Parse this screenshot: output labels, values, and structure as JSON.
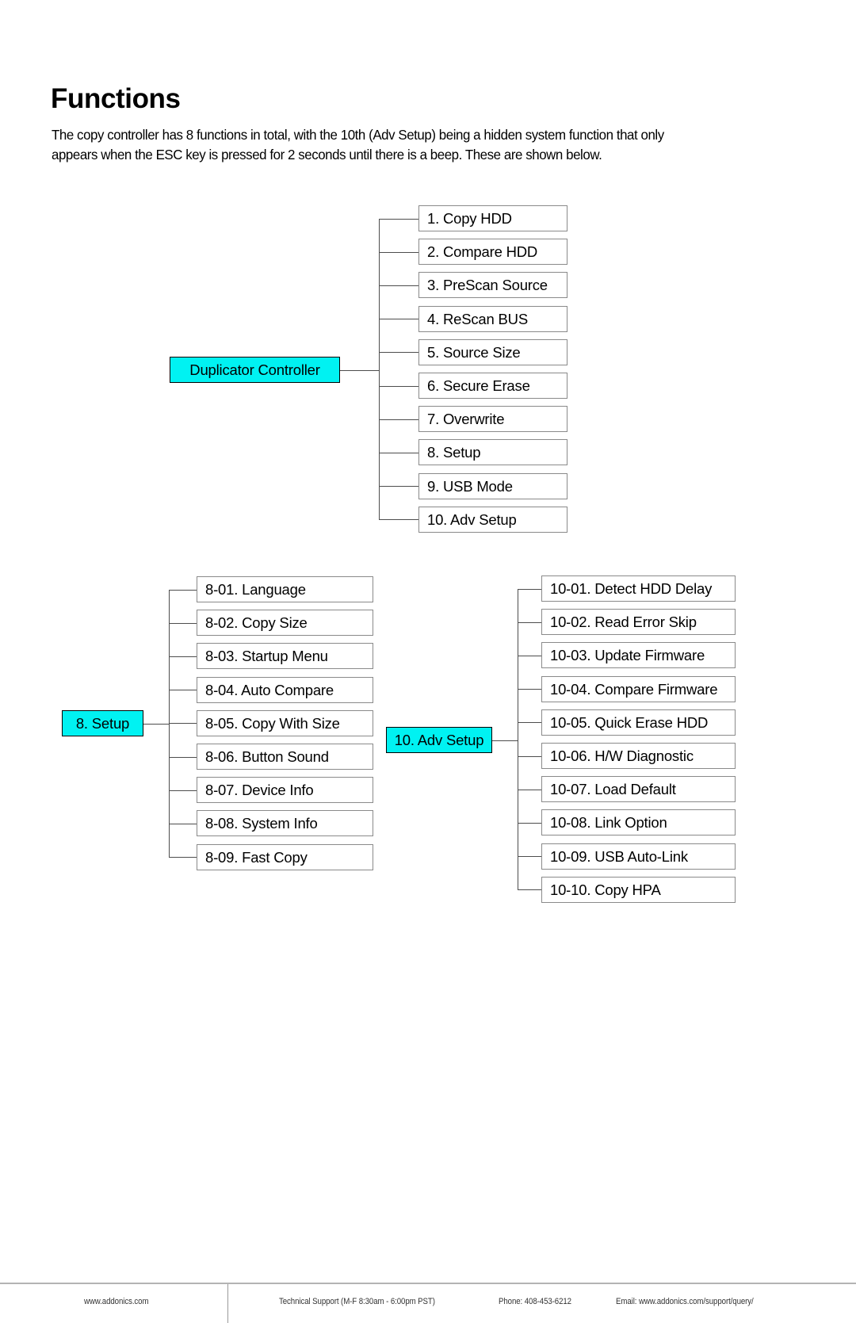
{
  "page": {
    "title": "Functions",
    "intro": "The copy controller has 8 functions in total, with the 10th (Adv Setup) being a hidden system function that only appears when the ESC key is pressed for 2 seconds until there is a beep. These are shown below.",
    "accent_color": "#00f2f2",
    "box_border_color": "#8a8a8a",
    "line_color": "#4d4d4d"
  },
  "trees": [
    {
      "id": "duplicator-controller",
      "root": "Duplicator Controller",
      "children": [
        "1. Copy HDD",
        "2. Compare HDD",
        "3. PreScan Source",
        "4. ReScan BUS",
        "5. Source Size",
        "6. Secure Erase",
        "7. Overwrite",
        "8. Setup",
        "9. USB Mode",
        "10. Adv Setup"
      ]
    },
    {
      "id": "setup",
      "root": "8. Setup",
      "children": [
        "8-01. Language",
        "8-02. Copy Size",
        "8-03. Startup Menu",
        "8-04. Auto Compare",
        "8-05. Copy With Size",
        "8-06. Button Sound",
        "8-07. Device Info",
        "8-08. System Info",
        "8-09. Fast Copy"
      ]
    },
    {
      "id": "adv-setup",
      "root": "10. Adv Setup",
      "children": [
        "10-01. Detect HDD Delay",
        "10-02. Read Error Skip",
        "10-03. Update Firmware",
        "10-04. Compare Firmware",
        "10-05. Quick Erase HDD",
        "10-06. H/W Diagnostic",
        "10-07. Load  Default",
        "10-08. Link Option",
        "10-09. USB Auto-Link",
        "10-10. Copy HPA"
      ]
    }
  ],
  "footer": {
    "site": "www.addonics.com",
    "support": "Technical Support (M-F 8:30am - 6:00pm PST)",
    "phone": "Phone: 408-453-6212",
    "email": "Email: www.addonics.com/support/query/"
  }
}
